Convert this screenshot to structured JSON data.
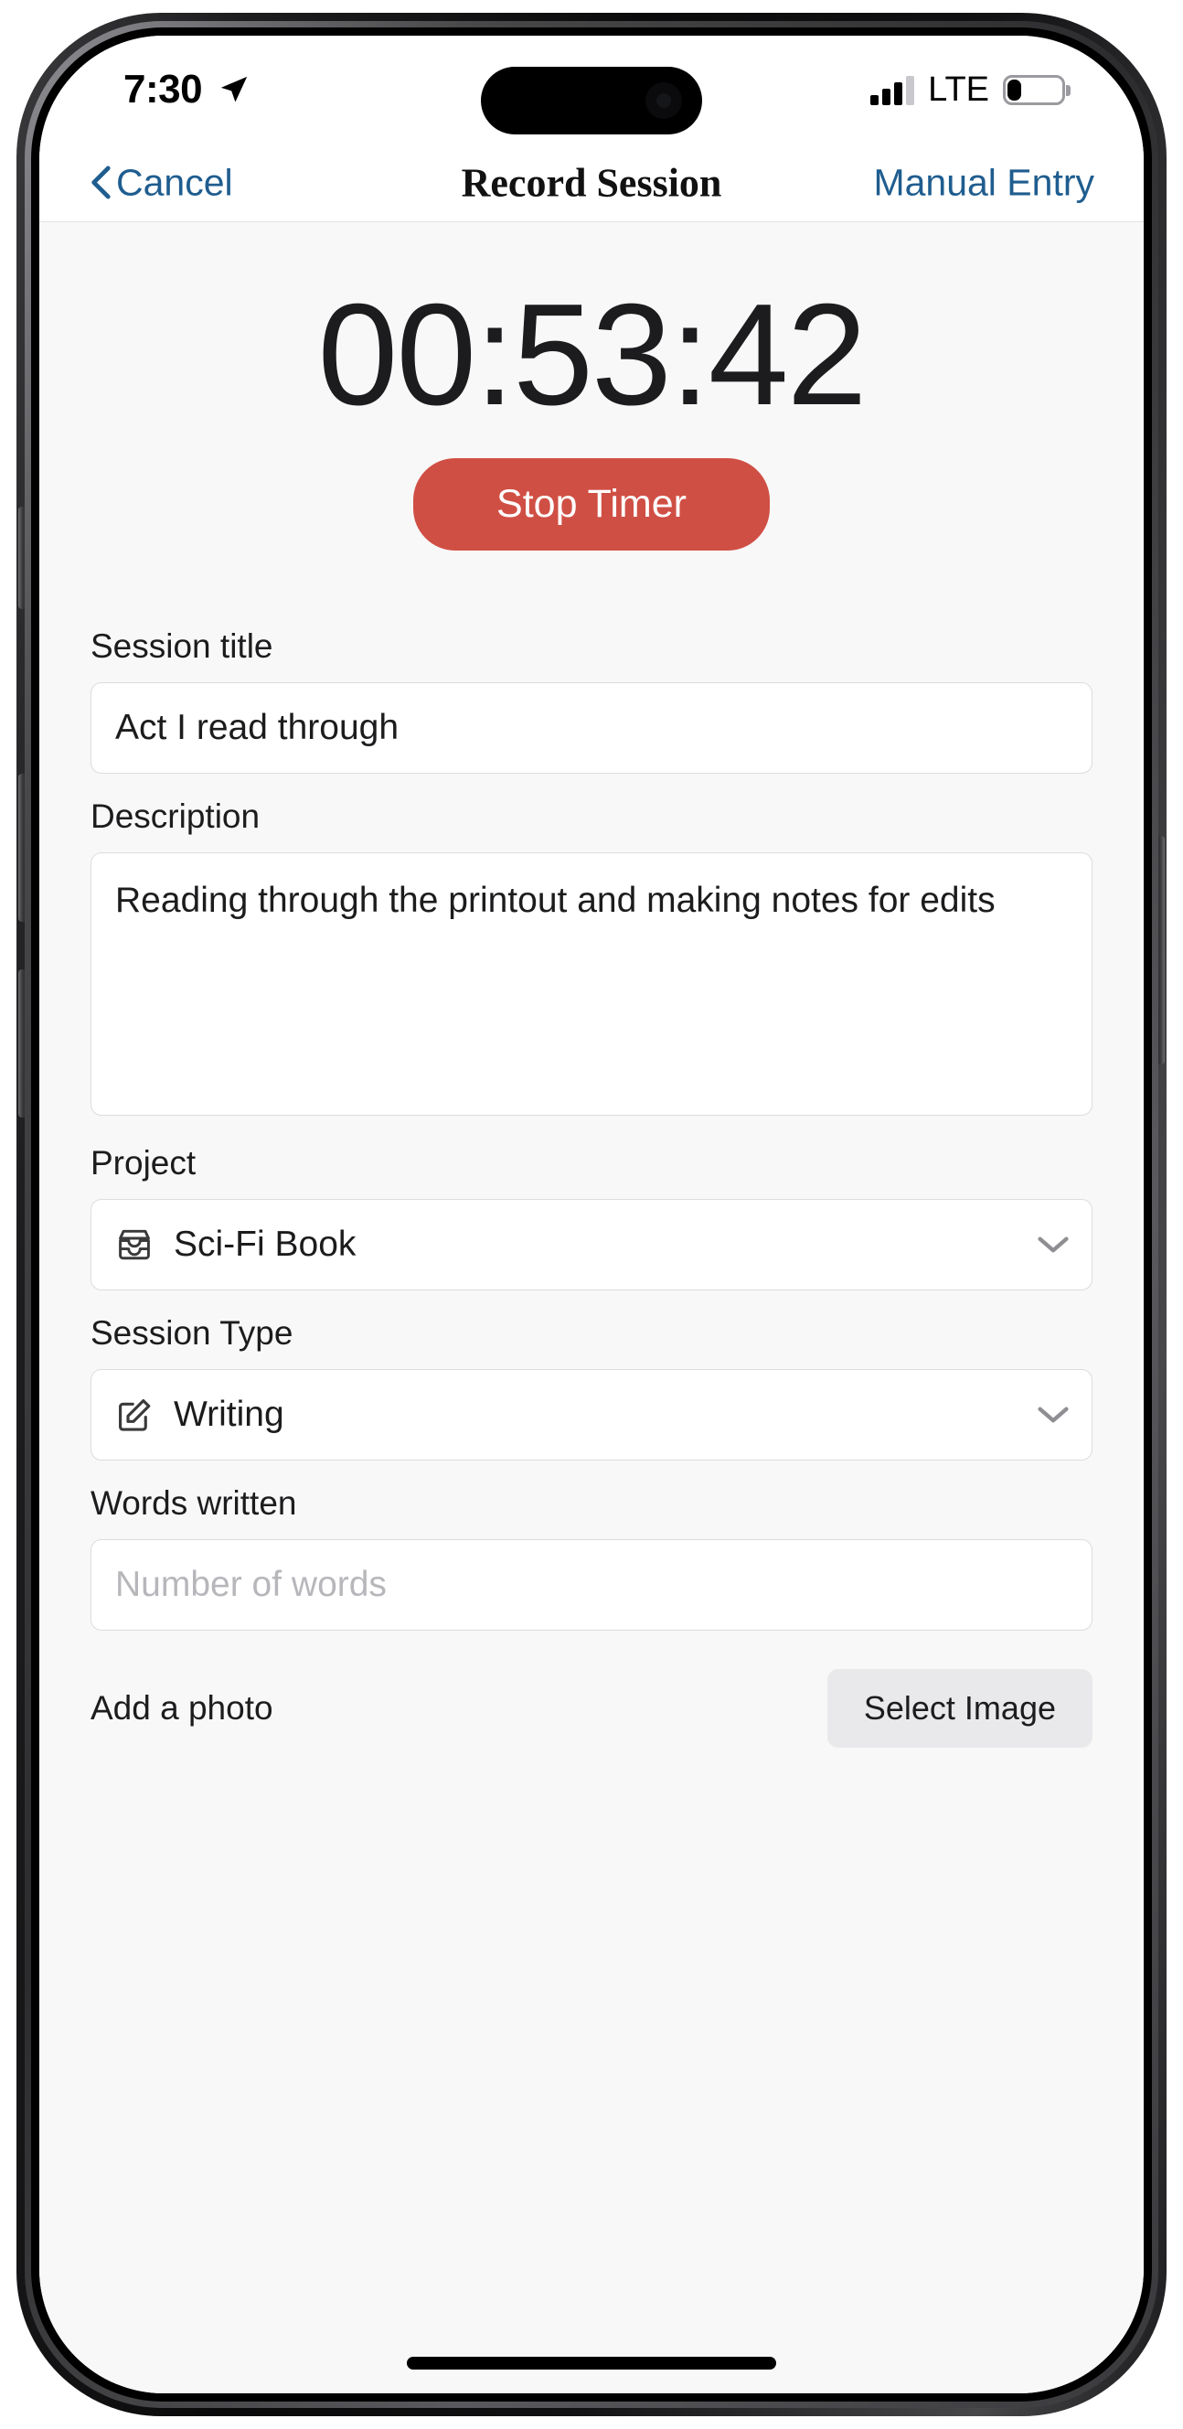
{
  "status_bar": {
    "time": "7:30",
    "location_icon": "location-arrow-icon",
    "carrier": "LTE",
    "signal_icon": "signal-bars-icon",
    "signal_bars_filled": 3,
    "signal_bars_total": 4,
    "battery_icon": "battery-icon",
    "battery_percent": 24
  },
  "nav": {
    "cancel_label": "Cancel",
    "back_icon": "chevron-left-icon",
    "title": "Record Session",
    "action_label": "Manual Entry"
  },
  "timer": {
    "elapsed": "00:53:42",
    "stop_label": "Stop Timer",
    "stop_color": "#D04F44"
  },
  "form": {
    "session_title": {
      "label": "Session title",
      "value": "Act I read through",
      "placeholder": "Session title"
    },
    "description": {
      "label": "Description",
      "value": "Reading through the printout and making notes for edits",
      "placeholder": "Description"
    },
    "project": {
      "label": "Project",
      "value": "Sci-Fi Book",
      "icon": "archive-box-icon",
      "chevron": "chevron-down-icon"
    },
    "session_type": {
      "label": "Session Type",
      "value": "Writing",
      "icon": "pencil-square-icon",
      "chevron": "chevron-down-icon"
    },
    "words_written": {
      "label": "Words written",
      "value": "",
      "placeholder": "Number of words"
    },
    "photo": {
      "label": "Add a photo",
      "button_label": "Select Image"
    }
  },
  "colors": {
    "accent_link": "#1f5d8f",
    "danger": "#D04F44",
    "page_bg": "#F8F8F8",
    "field_bg": "#FFFFFF",
    "field_border": "#DCDCDE"
  }
}
